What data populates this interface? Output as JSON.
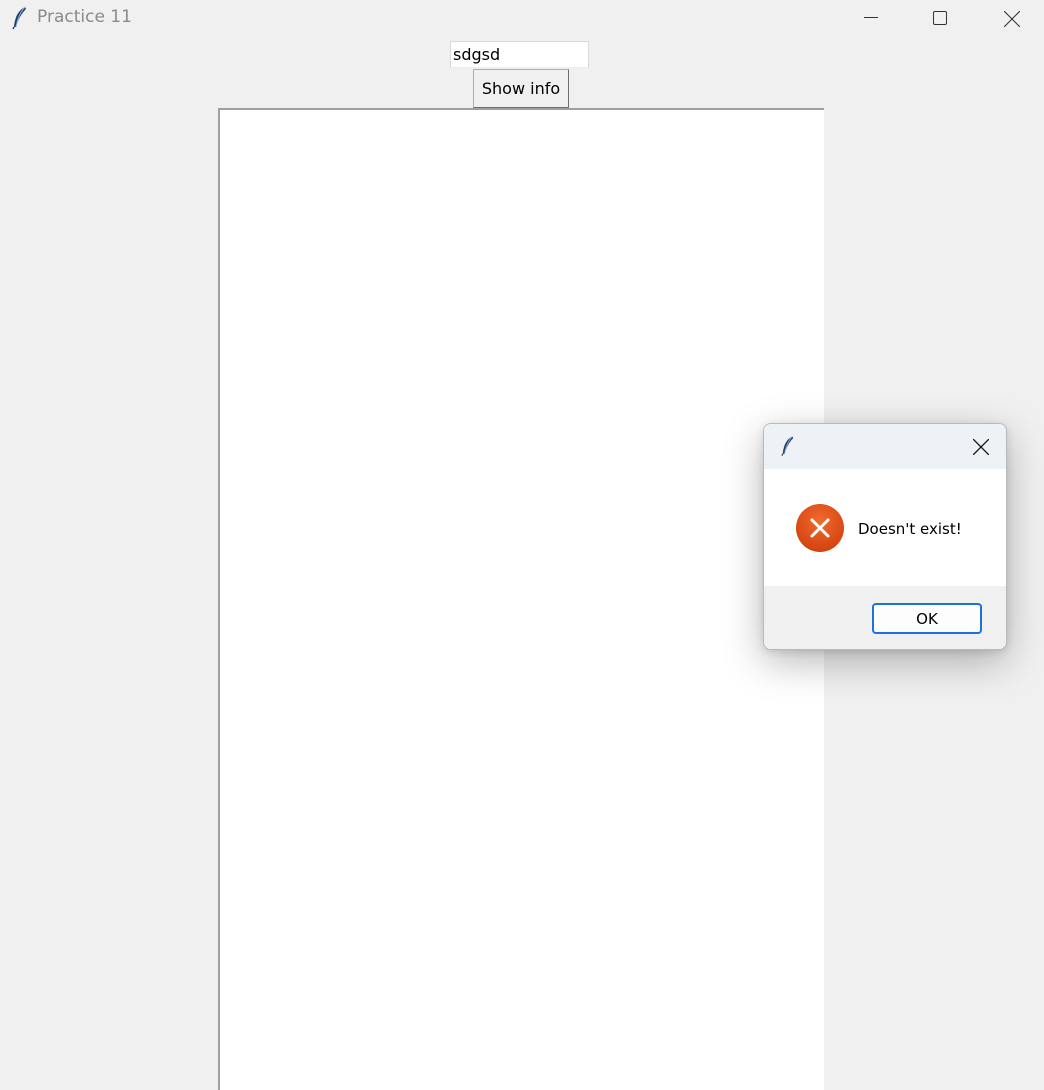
{
  "window": {
    "title": "Practice 11",
    "controls": {
      "minimize_icon": "minimize-icon",
      "maximize_icon": "maximize-icon",
      "close_icon": "close-icon"
    }
  },
  "main": {
    "entry_value": "sdgsd",
    "show_button_label": "Show info",
    "text_area_content": ""
  },
  "dialog": {
    "icon": "error-icon",
    "message": "Doesn't exist!",
    "ok_label": "OK",
    "error_color": "#e0501f"
  }
}
